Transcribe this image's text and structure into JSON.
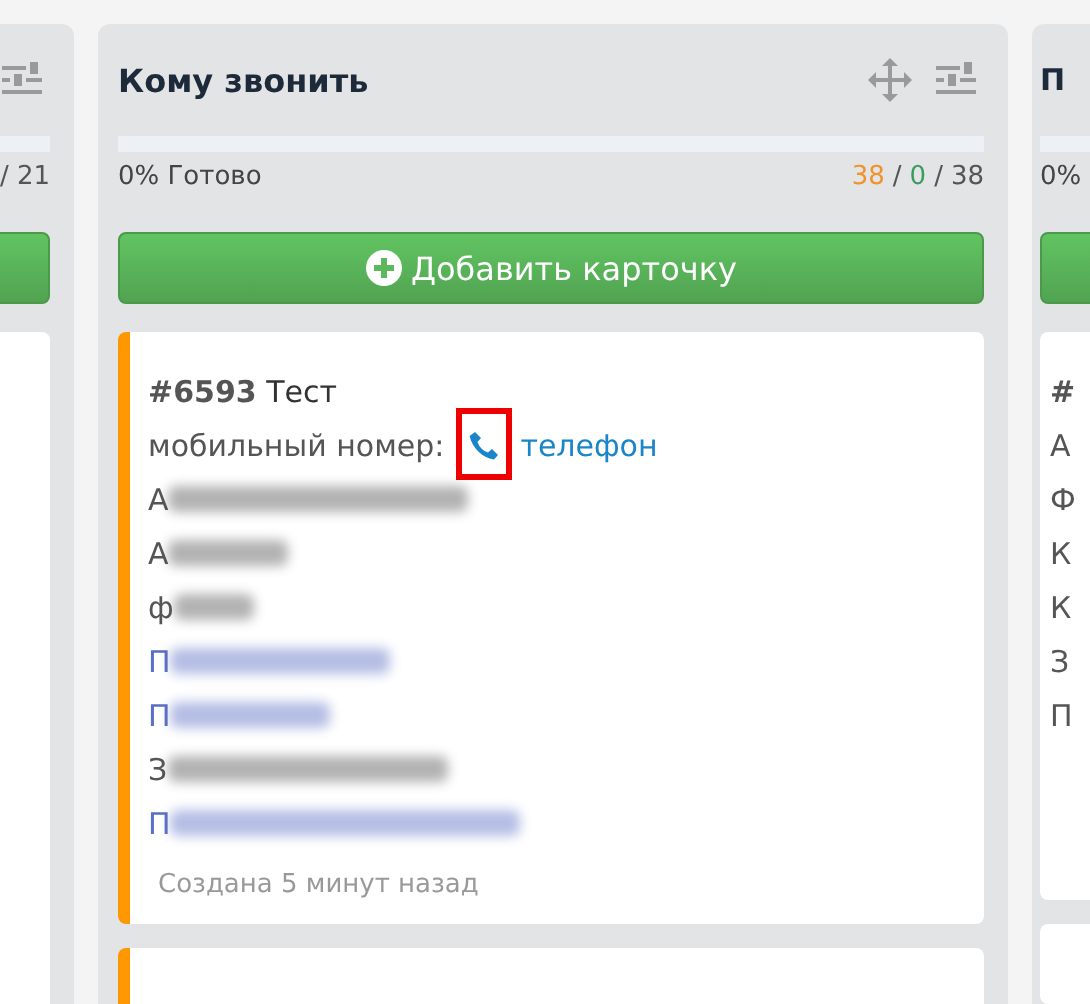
{
  "columns": [
    {
      "progress": {
        "counts": [
          "/ 21"
        ]
      },
      "cards": [
        {
          "kind": "blank"
        }
      ]
    },
    {
      "title": "Кому звонить",
      "progress": {
        "label": "0% Готово",
        "counts": [
          "38",
          "/",
          "0",
          "/",
          "38"
        ]
      },
      "add_button": "Добавить карточку",
      "cards": [
        {
          "kind": "full",
          "color": "#ff9800",
          "number": "#6593",
          "name": "Тест",
          "phone_label": "мобильный номер:",
          "phone_link": "телефон",
          "highlighted": true,
          "lines": [
            "А",
            "А",
            "ф",
            "П",
            "П",
            "З",
            "П"
          ],
          "footer": "Создана 5 минут назад"
        },
        {
          "kind": "stub",
          "color": "#ff9800"
        }
      ]
    },
    {
      "title": "П",
      "progress": {
        "label": "0%"
      },
      "cards": [
        {
          "kind": "letters",
          "number": "#",
          "lines": [
            "А",
            "Ф",
            "К",
            "К",
            "З",
            "П"
          ]
        },
        {
          "kind": "stub",
          "color": "#ffffff"
        }
      ]
    }
  ]
}
